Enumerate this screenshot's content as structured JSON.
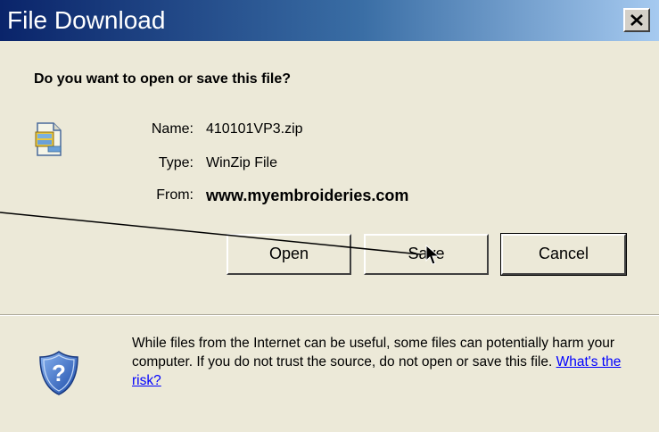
{
  "window": {
    "title": "File Download"
  },
  "dialog": {
    "question": "Do you want to open or save this file?",
    "file": {
      "name_label": "Name:",
      "name_value": "410101VP3.zip",
      "type_label": "Type:",
      "type_value": "WinZip File",
      "from_label": "From:",
      "from_value": "www.myembroideries.com"
    },
    "buttons": {
      "open": "Open",
      "save": "Save",
      "cancel": "Cancel"
    },
    "warning": {
      "text": "While files from the Internet can be useful, some files can potentially harm your computer. If you do not trust the source, do not open or save this file. ",
      "link": "What's the risk?"
    }
  },
  "icons": {
    "file": "zip-file-icon",
    "shield": "security-shield-question-icon",
    "close": "close-icon",
    "pointer": "arrow-pointer-icon"
  },
  "colors": {
    "title_start": "#0a246a",
    "title_end": "#a6caf0",
    "dialog_bg": "#ece9d8",
    "link": "#0000ff"
  }
}
